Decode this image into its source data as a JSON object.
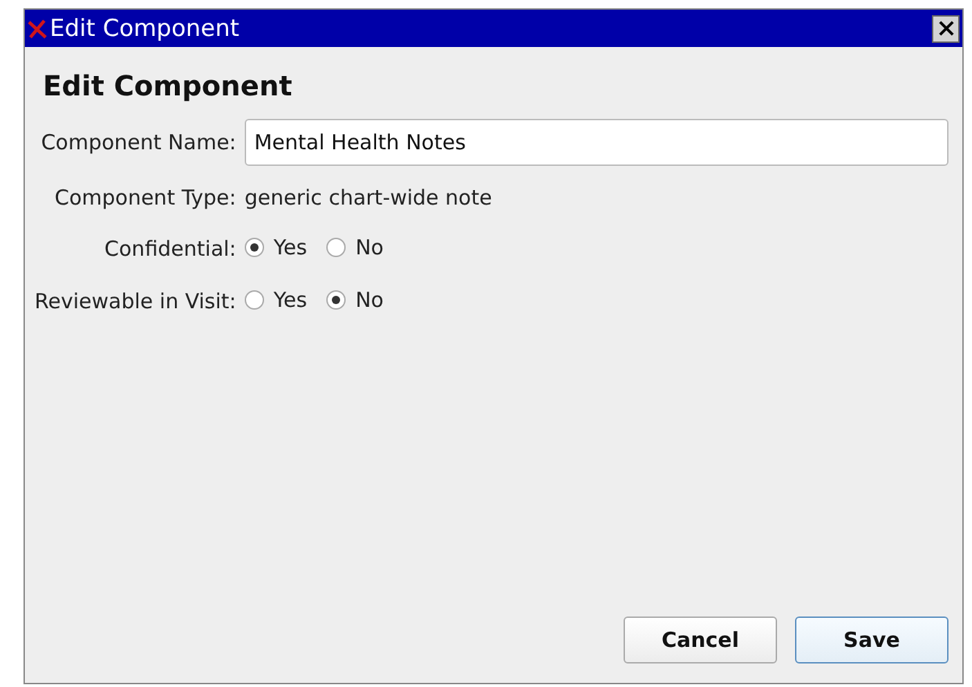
{
  "window": {
    "title": "Edit Component"
  },
  "heading": "Edit Component",
  "fields": [
    {
      "kind": "input",
      "label": "Component Name:",
      "value": "Mental Health Notes"
    },
    {
      "kind": "text",
      "label": "Component Type:",
      "value": "generic chart-wide note"
    },
    {
      "kind": "radio",
      "label": "Confidential:",
      "options": [
        {
          "label": "Yes",
          "selected": true
        },
        {
          "label": "No",
          "selected": false
        }
      ]
    },
    {
      "kind": "radio",
      "label": "Reviewable in Visit:",
      "options": [
        {
          "label": "Yes",
          "selected": false
        },
        {
          "label": "No",
          "selected": true
        }
      ]
    }
  ],
  "buttons": [
    {
      "label": "Cancel",
      "default": false
    },
    {
      "label": "Save",
      "default": true
    }
  ]
}
